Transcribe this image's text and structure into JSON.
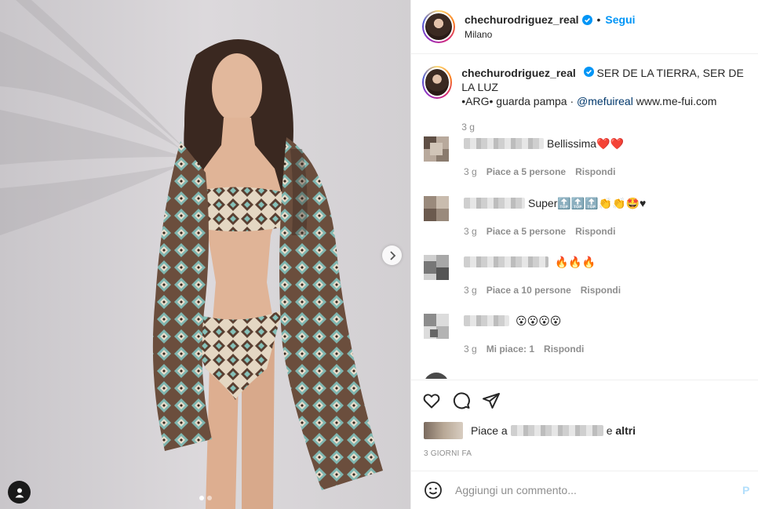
{
  "post": {
    "username": "chechurodriguez_real",
    "bullet": "•",
    "follow_label": "Segui",
    "location": "Milano",
    "caption_text": "SER DE LA TIERRA, SER DE LA LUZ",
    "caption_line2_pre": "•ARG• guarda pampa · ",
    "caption_mention": "@mefuireal",
    "caption_link": " www.me-fui.com",
    "caption_age": "3 g"
  },
  "comments": [
    {
      "text": "Bellissima",
      "emoji": "❤️❤️",
      "age": "3 g",
      "likes": "Piace a 5 persone",
      "reply": "Rispondi"
    },
    {
      "text": "Super",
      "emoji": "🔝🔝🔝👏👏🤩♥",
      "age": "3 g",
      "likes": "Piace a 5 persone",
      "reply": "Rispondi"
    },
    {
      "text": "",
      "emoji": "🔥🔥🔥",
      "age": "3 g",
      "likes": "Piace a 10 persone",
      "reply": "Rispondi"
    },
    {
      "text": "",
      "emoji": "😮😮😮😮",
      "age": "3 g",
      "likes": "Mi piace: 1",
      "reply": "Rispondi"
    }
  ],
  "likes_row": {
    "prefix": "Piace a",
    "suffix": "e",
    "others": "altri"
  },
  "timestamp": "3 GIORNI FA",
  "add_comment": {
    "placeholder": "Aggiungi un commento...",
    "publish": "P"
  },
  "icons": {
    "verified": "verified-badge-icon",
    "like": "heart-icon",
    "comment": "speech-bubble-icon",
    "share": "paper-plane-icon",
    "emoji": "smiley-icon",
    "next": "chevron-right-icon",
    "tag": "user-icon"
  },
  "colors": {
    "accent": "#0095f6",
    "mention": "#00376b",
    "muted": "#8e8e8e",
    "text": "#262626"
  }
}
